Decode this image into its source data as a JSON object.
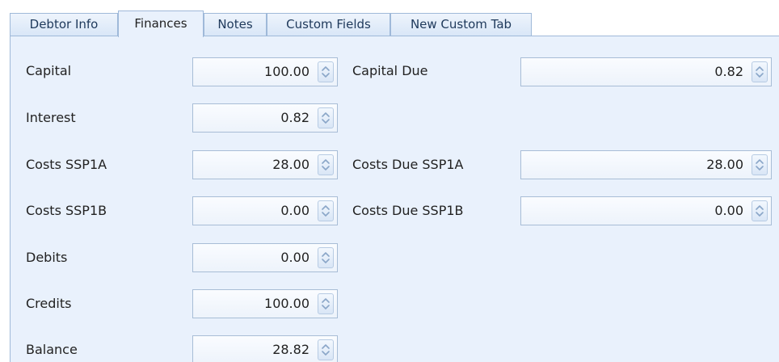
{
  "tabs": [
    {
      "label": "Debtor Info",
      "active": false
    },
    {
      "label": "Finances",
      "active": true
    },
    {
      "label": "Notes",
      "active": false
    },
    {
      "label": "Custom Fields",
      "active": false
    },
    {
      "label": "New Custom Tab",
      "active": false
    }
  ],
  "finances": {
    "capital": {
      "label": "Capital",
      "value": "100.00"
    },
    "interest": {
      "label": "Interest",
      "value": "0.82"
    },
    "costs_ssp1a": {
      "label": "Costs SSP1A",
      "value": "28.00"
    },
    "costs_ssp1b": {
      "label": "Costs SSP1B",
      "value": "0.00"
    },
    "debits": {
      "label": "Debits",
      "value": "0.00"
    },
    "credits": {
      "label": "Credits",
      "value": "100.00"
    },
    "balance": {
      "label": "Balance",
      "value": "28.82"
    },
    "capital_due": {
      "label": "Capital Due",
      "value": "0.82"
    },
    "costs_due_ssp1a": {
      "label": "Costs Due SSP1A",
      "value": "28.00"
    },
    "costs_due_ssp1b": {
      "label": "Costs Due SSP1B",
      "value": "0.00"
    }
  },
  "colors": {
    "panel_bg": "#e9f1fc",
    "border": "#9fb9d9",
    "tab_text": "#1e395b"
  },
  "icons": {
    "spinner": "spin-updown-icon"
  }
}
